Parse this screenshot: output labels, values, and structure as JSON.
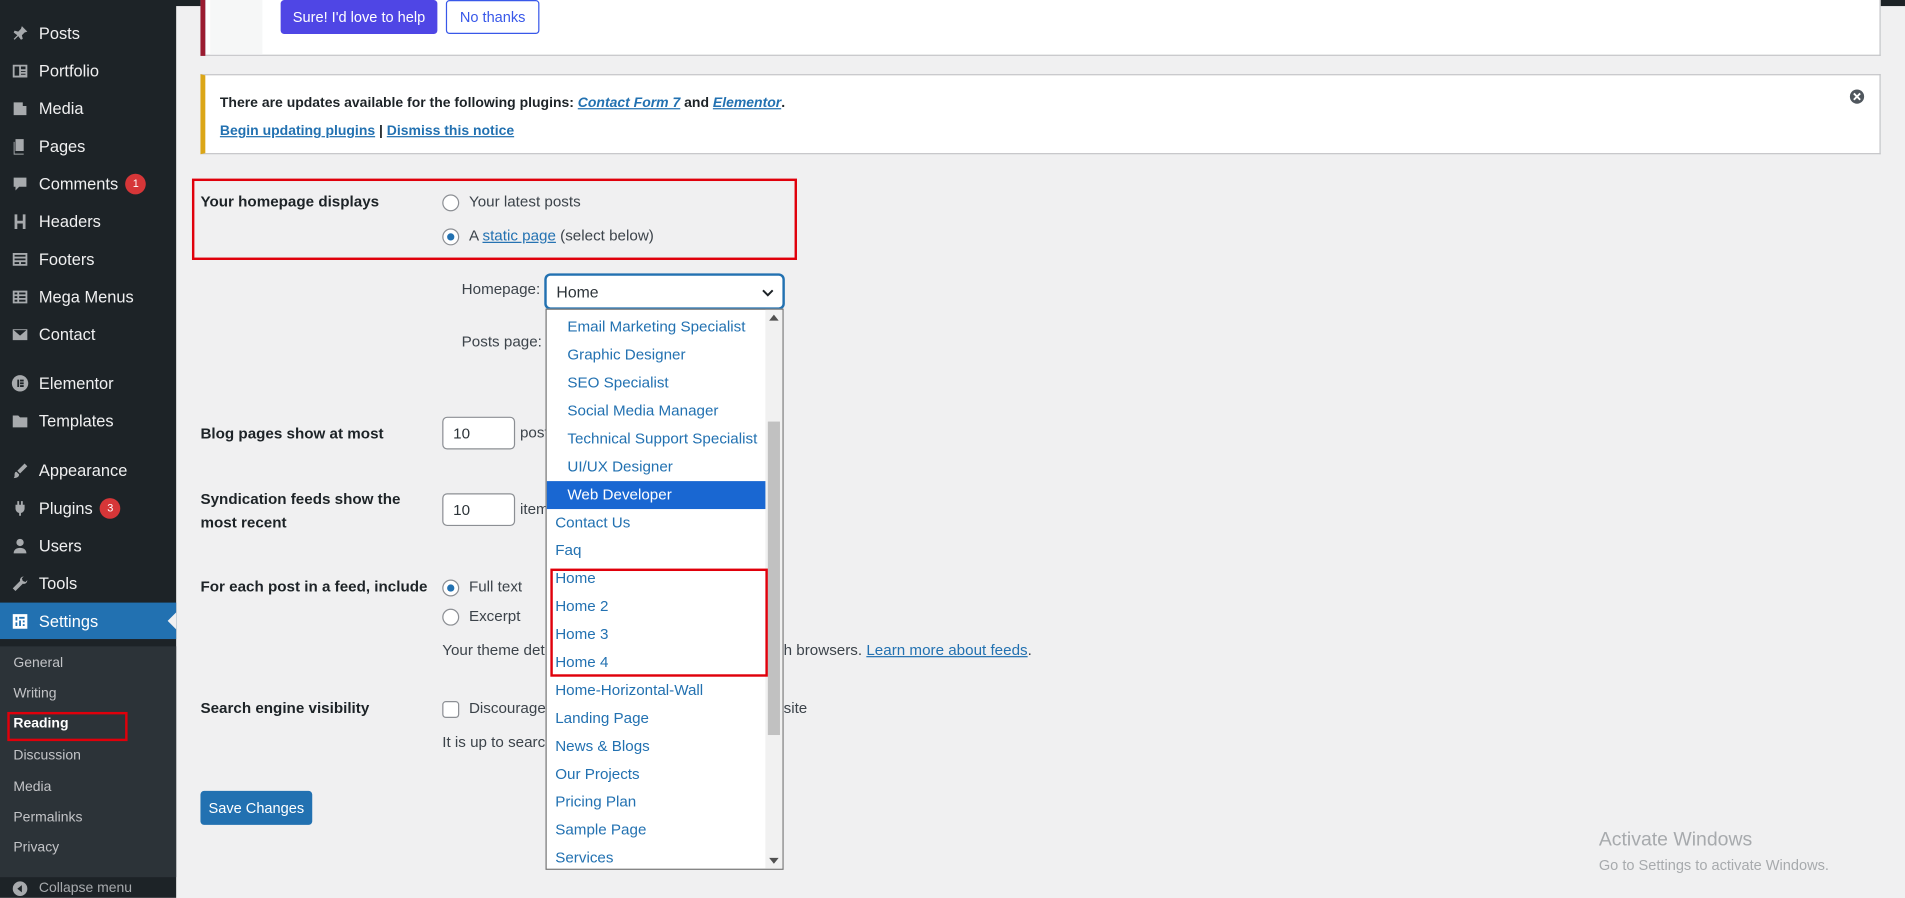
{
  "sidebar": {
    "items": [
      {
        "label": "Posts",
        "icon": "pin-icon",
        "badge": ""
      },
      {
        "label": "Portfolio",
        "icon": "portfolio-icon",
        "badge": ""
      },
      {
        "label": "Media",
        "icon": "media-icon",
        "badge": ""
      },
      {
        "label": "Pages",
        "icon": "pages-icon",
        "badge": ""
      },
      {
        "label": "Comments",
        "icon": "comment-icon",
        "badge": "1"
      },
      {
        "label": "Headers",
        "icon": "heading-icon",
        "badge": ""
      },
      {
        "label": "Footers",
        "icon": "footer-icon",
        "badge": ""
      },
      {
        "label": "Mega Menus",
        "icon": "menu-icon",
        "badge": ""
      },
      {
        "label": "Contact",
        "icon": "mail-icon",
        "badge": ""
      },
      {
        "label": "Elementor",
        "icon": "elementor-icon",
        "badge": ""
      },
      {
        "label": "Templates",
        "icon": "folder-icon",
        "badge": ""
      },
      {
        "label": "Appearance",
        "icon": "brush-icon",
        "badge": ""
      },
      {
        "label": "Plugins",
        "icon": "plugin-icon",
        "badge": "3"
      },
      {
        "label": "Users",
        "icon": "user-icon",
        "badge": ""
      },
      {
        "label": "Tools",
        "icon": "wrench-icon",
        "badge": ""
      },
      {
        "label": "Settings",
        "icon": "settings-icon",
        "badge": ""
      }
    ],
    "submenu": [
      "General",
      "Writing",
      "Reading",
      "Discussion",
      "Media",
      "Permalinks",
      "Privacy"
    ],
    "collapse_label": "Collapse menu"
  },
  "promo": {
    "yes_label": "Sure! I'd love to help",
    "no_label": "No thanks"
  },
  "update_notice": {
    "prefix": "There are updates available for the following plugins: ",
    "plugin1": "Contact Form 7",
    "and": " and ",
    "plugin2": "Elementor",
    "suffix": ".",
    "begin_link": "Begin updating plugins",
    "sep": " | ",
    "dismiss_link": "Dismiss this notice"
  },
  "reading": {
    "homepage_displays_label": "Your homepage displays",
    "latest_posts_label": "Your latest posts",
    "static_prefix": "A ",
    "static_link": "static page",
    "static_suffix": " (select below)",
    "homepage_label": "Homepage:",
    "homepage_value": "Home",
    "posts_page_label": "Posts page:",
    "blog_pages_label": "Blog pages show at most",
    "blog_pages_value": "10",
    "blog_pages_unit": "post",
    "feeds_label_1": "Syndication feeds show the",
    "feeds_label_2": "most recent",
    "feeds_value": "10",
    "feeds_unit": "item",
    "feed_include_label": "For each post in a feed, include",
    "full_text_label": "Full text",
    "excerpt_label": "Excerpt",
    "theme_note_start": "Your theme det",
    "theme_note_end": "h browsers. ",
    "learn_more_link": "Learn more about feeds",
    "learn_more_suffix": ".",
    "search_visibility_label": "Search engine visibility",
    "discourage_start": "Discourage",
    "discourage_end": "site",
    "up_to_note": "It is up to searc",
    "save_label": "Save Changes"
  },
  "dropdown": {
    "options": [
      {
        "label": "Email Marketing Specialist",
        "child": true
      },
      {
        "label": "Graphic Designer",
        "child": true
      },
      {
        "label": "SEO Specialist",
        "child": true
      },
      {
        "label": "Social Media Manager",
        "child": true
      },
      {
        "label": "Technical Support Specialist",
        "child": true
      },
      {
        "label": "UI/UX Designer",
        "child": true
      },
      {
        "label": "Web Developer",
        "child": true,
        "selected": true
      },
      {
        "label": "Contact Us",
        "child": false
      },
      {
        "label": "Faq",
        "child": false
      },
      {
        "label": "Home",
        "child": false
      },
      {
        "label": "Home 2",
        "child": false
      },
      {
        "label": "Home 3",
        "child": false
      },
      {
        "label": "Home 4",
        "child": false
      },
      {
        "label": "Home-Horizontal-Wall",
        "child": false
      },
      {
        "label": "Landing Page",
        "child": false
      },
      {
        "label": "News & Blogs",
        "child": false
      },
      {
        "label": "Our Projects",
        "child": false
      },
      {
        "label": "Pricing Plan",
        "child": false
      },
      {
        "label": "Sample Page",
        "child": false
      },
      {
        "label": "Services",
        "child": false
      }
    ]
  },
  "watermark": {
    "line1": "Activate Windows",
    "line2": "Go to Settings to activate Windows."
  },
  "colors": {
    "accent": "#2271b1",
    "sidebar": "#1d2327",
    "highlight": "#e0000b",
    "badge": "#d63638"
  }
}
